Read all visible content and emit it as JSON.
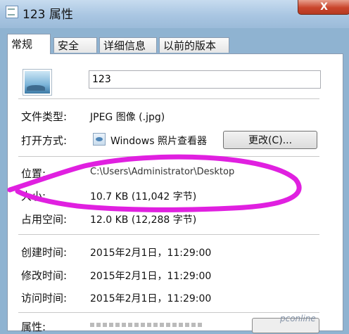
{
  "window": {
    "title": "123 属性",
    "close_label": "X"
  },
  "tabs": [
    {
      "label": "常规"
    },
    {
      "label": "安全"
    },
    {
      "label": "详细信息"
    },
    {
      "label": "以前的版本"
    }
  ],
  "general": {
    "filename": "123",
    "file_type_label": "文件类型:",
    "file_type_value": "JPEG 图像 (.jpg)",
    "open_with_label": "打开方式:",
    "open_with_value": "Windows 照片查看器",
    "change_button_label": "更改(C)...",
    "location_label": "位置:",
    "location_value": "C:\\Users\\Administrator\\Desktop",
    "size_label": "大小:",
    "size_value": "10.7 KB (11,042 字节)",
    "size_on_disk_label": "占用空间:",
    "size_on_disk_value": "12.0 KB (12,288 字节)",
    "created_label": "创建时间:",
    "created_value": "2015年2月1日，11:29:00",
    "modified_label": "修改时间:",
    "modified_value": "2015年2月1日，11:29:00",
    "accessed_label": "访问时间:",
    "accessed_value": "2015年2月1日，11:29:00",
    "attributes_label": "属性:"
  },
  "watermark": "pconline",
  "colors": {
    "annotation_stroke": "#e020e0",
    "close_button": "#c9452c"
  },
  "icons": {
    "title": "properties-icon",
    "file": "image-file-icon",
    "app": "photo-viewer-icon"
  }
}
